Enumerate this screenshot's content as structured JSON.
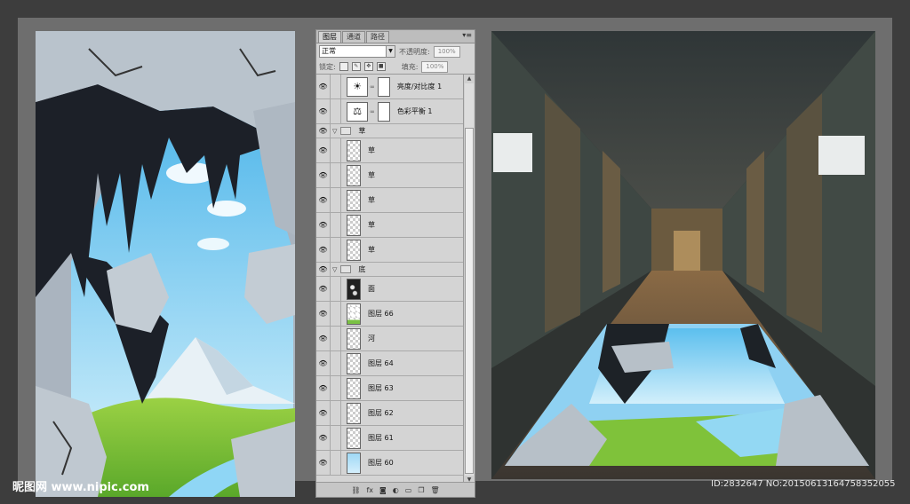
{
  "panel": {
    "tabs": [
      "图层",
      "通道",
      "路径"
    ],
    "menu_icon": "▾≡",
    "blend_mode": "正常",
    "opacity_label": "不透明度:",
    "opacity_value": "100%",
    "lock_label": "锁定:",
    "fill_label": "填充:",
    "fill_value": "100%",
    "layers": [
      {
        "name": "亮度/对比度 1",
        "kind": "adjustment",
        "icon": "sun-icon"
      },
      {
        "name": "色彩平衡 1",
        "kind": "adjustment",
        "icon": "balance-icon"
      },
      {
        "name": "草",
        "kind": "group"
      },
      {
        "name": "草",
        "kind": "layer"
      },
      {
        "name": "草",
        "kind": "layer"
      },
      {
        "name": "草",
        "kind": "layer"
      },
      {
        "name": "草",
        "kind": "layer"
      },
      {
        "name": "草",
        "kind": "layer"
      },
      {
        "name": "底",
        "kind": "group"
      },
      {
        "name": "面",
        "kind": "layer-dark"
      },
      {
        "name": "图层 66",
        "kind": "layer-green"
      },
      {
        "name": "河",
        "kind": "layer"
      },
      {
        "name": "图层 64",
        "kind": "layer"
      },
      {
        "name": "图层 63",
        "kind": "layer"
      },
      {
        "name": "图层 62",
        "kind": "layer"
      },
      {
        "name": "图层 61",
        "kind": "layer"
      },
      {
        "name": "图层 60",
        "kind": "layer-sky"
      }
    ],
    "footer_icons": [
      "link-icon",
      "fx-icon",
      "mask-icon",
      "adjustment-icon",
      "folder-icon",
      "new-layer-icon",
      "trash-icon"
    ]
  },
  "watermark": "昵图网 www.nipic.com",
  "image_id": "ID:2832647 NO:20150613164758352055",
  "colors": {
    "sky": "#7fd0f2",
    "grass": "#8ccc3a",
    "rock": "#b9c3cc",
    "cave": "#1c2028",
    "corridor": "#3b3c3a"
  }
}
